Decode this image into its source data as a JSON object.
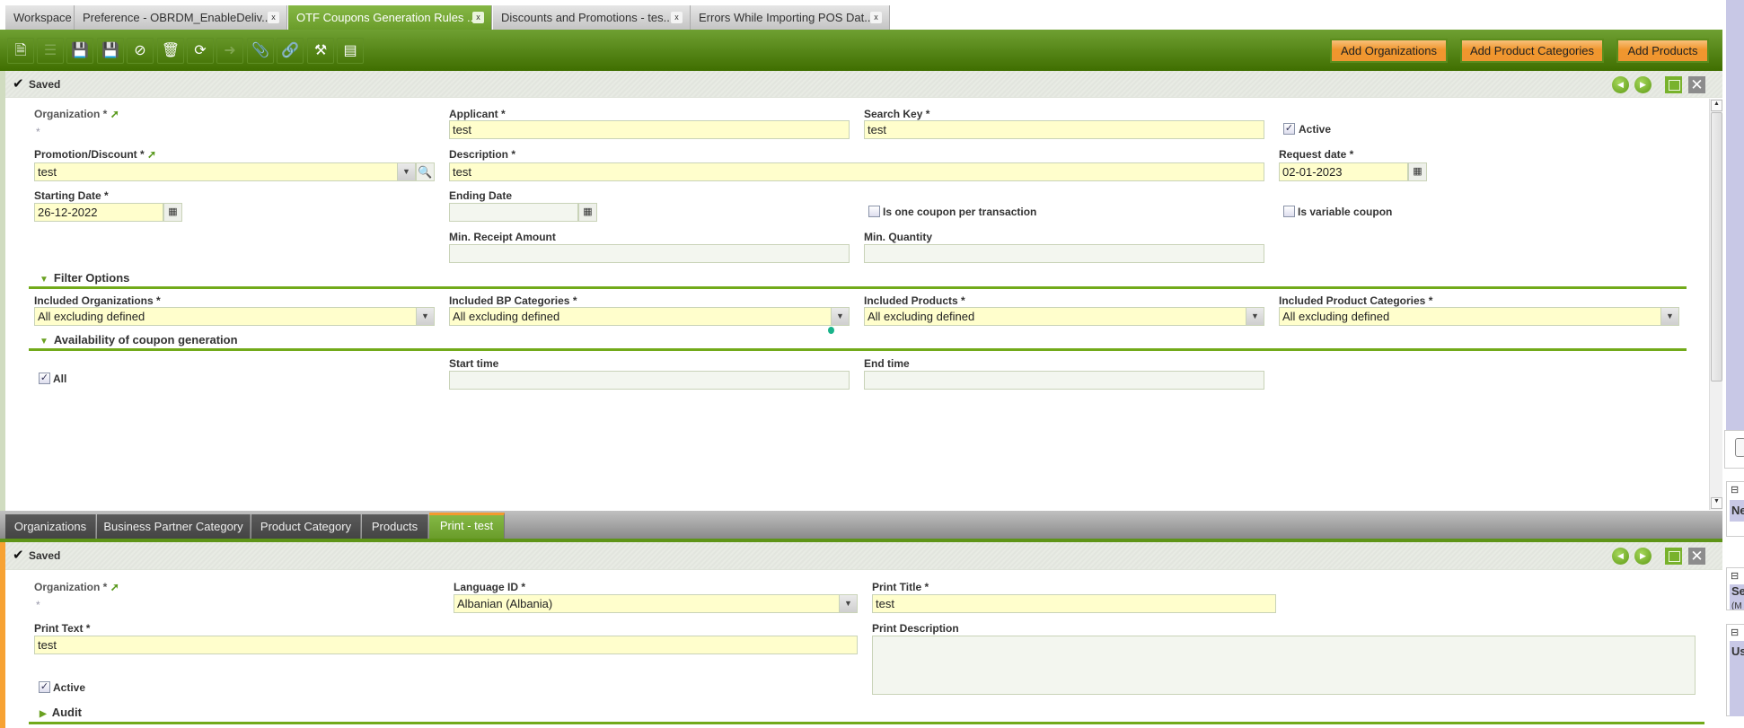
{
  "window_tabs": [
    {
      "label": "Workspace"
    },
    {
      "label": "Preference - OBRDM_EnableDeliv...",
      "close": "x"
    },
    {
      "label": "OTF Coupons Generation Rules ...",
      "close": "x",
      "active": true
    },
    {
      "label": "Discounts and Promotions - tes...",
      "close": "x"
    },
    {
      "label": "Errors While Importing POS Dat...",
      "close": "x"
    }
  ],
  "toolbar": {
    "icons": [
      "new-document-icon",
      "grid-view-icon",
      "save-icon",
      "save-close-icon",
      "undo-icon",
      "delete-icon",
      "refresh-icon",
      "export-icon",
      "attachment-icon",
      "link-icon",
      "tools-icon",
      "layout-icon"
    ],
    "buttons": {
      "add_organizations": "Add Organizations",
      "add_product_categories": "Add Product Categories",
      "add_products": "Add Products"
    }
  },
  "header": {
    "status": "Saved"
  },
  "form": {
    "organization": {
      "label": "Organization *",
      "value": "*"
    },
    "applicant": {
      "label": "Applicant *",
      "value": "test"
    },
    "search_key": {
      "label": "Search Key *",
      "value": "test"
    },
    "active": {
      "label": "Active",
      "checked": true
    },
    "promotion": {
      "label": "Promotion/Discount *",
      "value": "test"
    },
    "description": {
      "label": "Description *",
      "value": "test"
    },
    "request_date": {
      "label": "Request date *",
      "value": "02-01-2023"
    },
    "starting_date": {
      "label": "Starting Date *",
      "value": "26-12-2022"
    },
    "ending_date": {
      "label": "Ending Date",
      "value": ""
    },
    "one_coupon": {
      "label": "Is one coupon per transaction",
      "checked": false
    },
    "variable_coupon": {
      "label": "Is variable coupon",
      "checked": false
    },
    "min_receipt": {
      "label": "Min. Receipt Amount",
      "value": ""
    },
    "min_quantity": {
      "label": "Min. Quantity",
      "value": ""
    },
    "filter_section": "Filter Options",
    "included_orgs": {
      "label": "Included Organizations *",
      "value": "All excluding defined"
    },
    "included_bp": {
      "label": "Included BP Categories *",
      "value": "All excluding defined"
    },
    "included_products": {
      "label": "Included Products *",
      "value": "All excluding defined"
    },
    "included_prodcat": {
      "label": "Included Product Categories *",
      "value": "All excluding defined"
    },
    "availability_section": "Availability of coupon generation",
    "all": {
      "label": "All",
      "checked": true
    },
    "start_time": {
      "label": "Start time",
      "value": ""
    },
    "end_time": {
      "label": "End time",
      "value": ""
    }
  },
  "subtabs": [
    {
      "label": "Organizations"
    },
    {
      "label": "Business Partner Category"
    },
    {
      "label": "Product Category"
    },
    {
      "label": "Products"
    },
    {
      "label": "Print - test",
      "active": true
    }
  ],
  "child": {
    "status": "Saved",
    "organization": {
      "label": "Organization *",
      "value": "*"
    },
    "language": {
      "label": "Language ID *",
      "value": "Albanian (Albania)"
    },
    "print_title": {
      "label": "Print Title *",
      "value": "test"
    },
    "print_text": {
      "label": "Print Text *",
      "value": "test"
    },
    "print_description": {
      "label": "Print Description",
      "value": ""
    },
    "active": {
      "label": "Active",
      "checked": true
    },
    "audit_section": "Audit"
  },
  "right_panel": {
    "items": [
      "Ne",
      "Se",
      "(M",
      "Us"
    ]
  },
  "colors": {
    "toolbar_green": "#4f8010",
    "accent_orange": "#f0962d",
    "required_yellow": "#fffecc",
    "panel_lavender": "#c8c8e6"
  }
}
